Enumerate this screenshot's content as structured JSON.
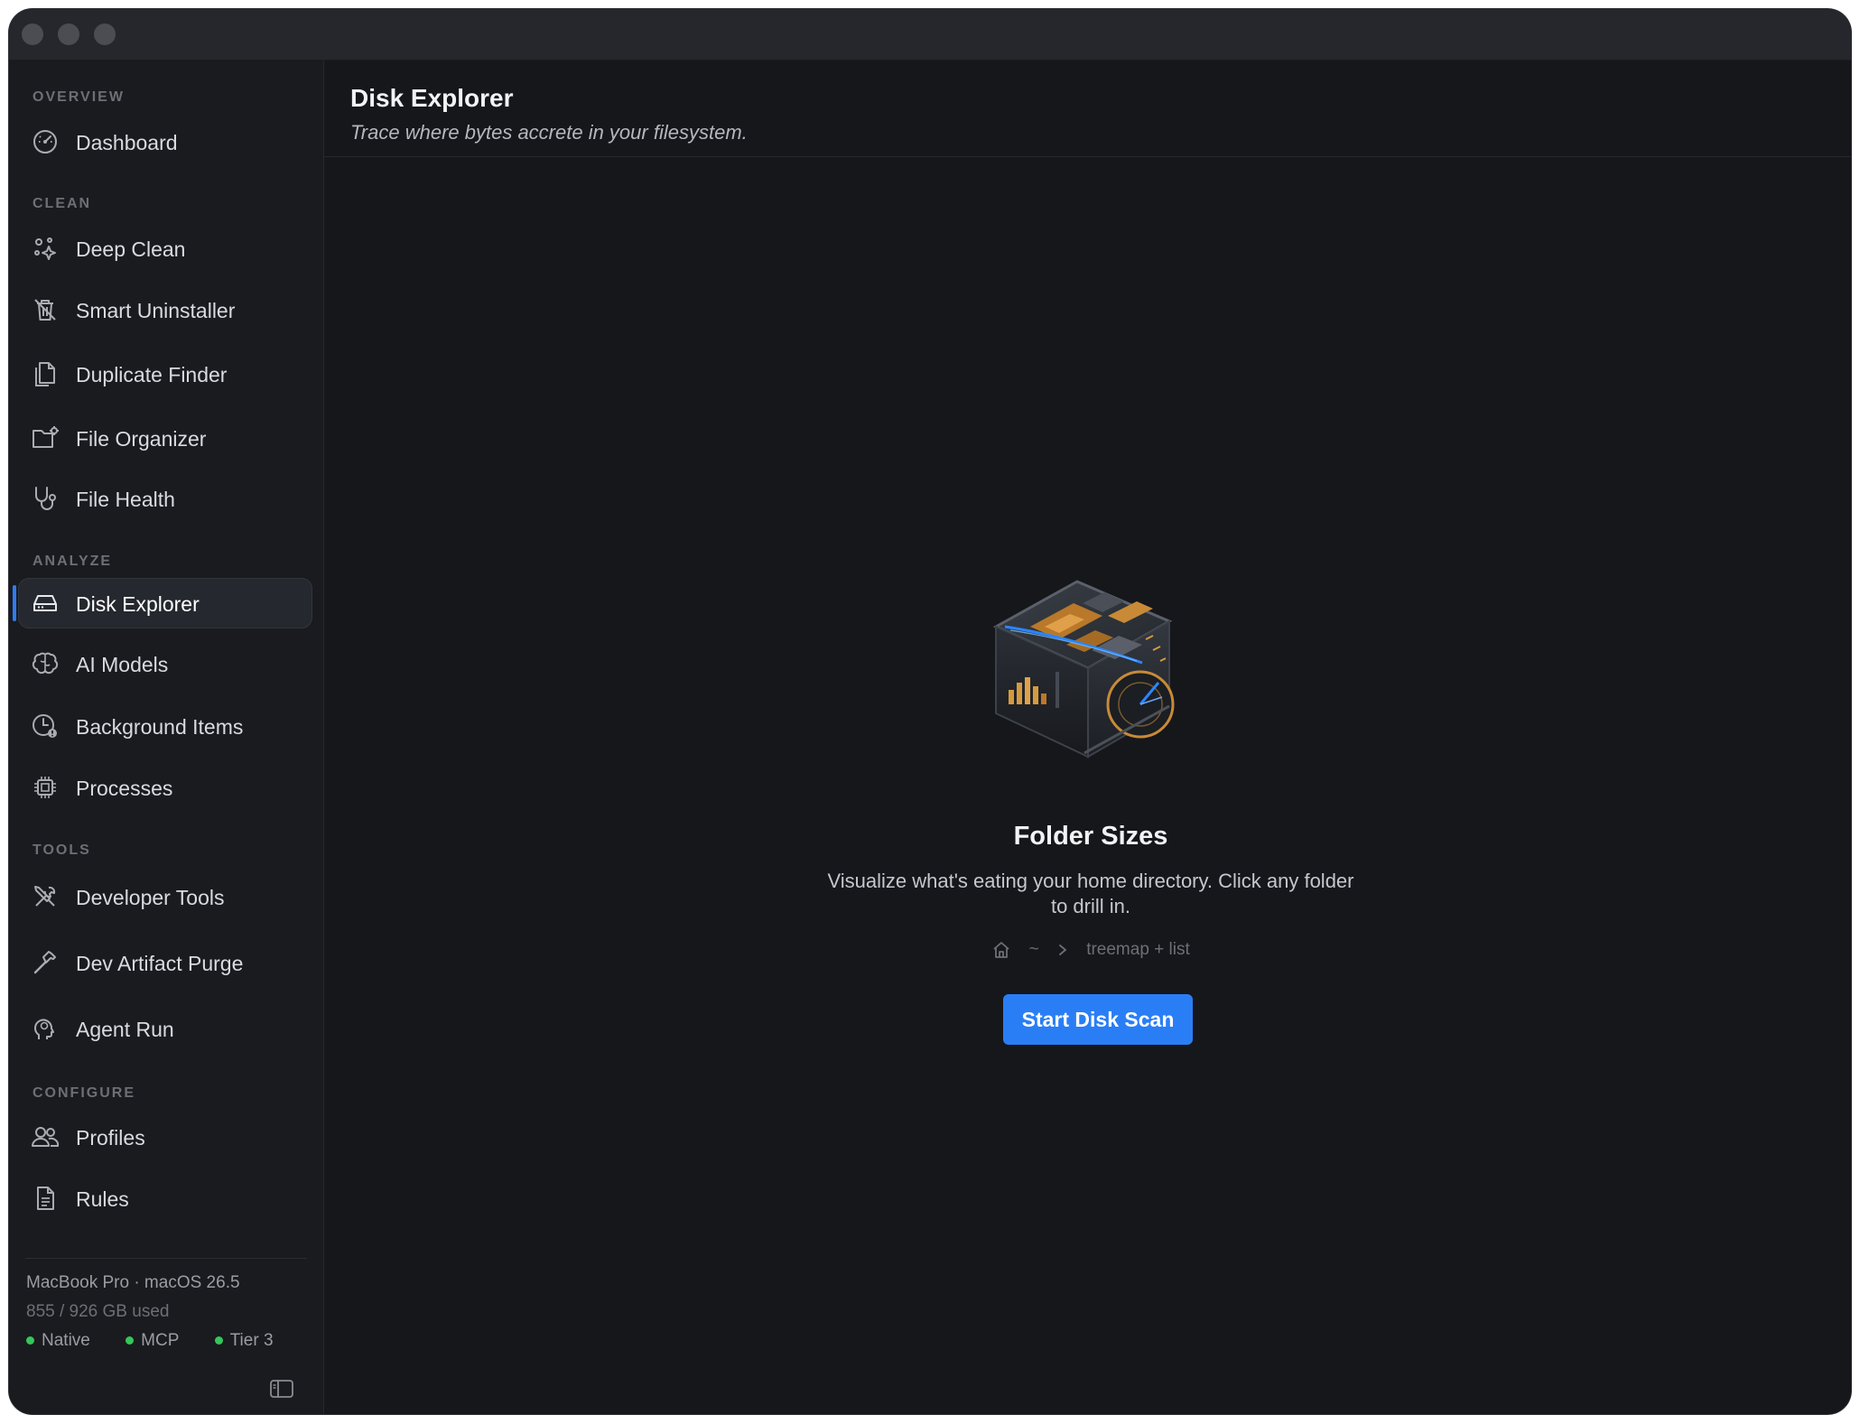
{
  "sidebar": {
    "sections": {
      "overview": "OVERVIEW",
      "clean": "CLEAN",
      "analyze": "ANALYZE",
      "tools": "TOOLS",
      "configure": "CONFIGURE"
    },
    "items": {
      "dashboard": "Dashboard",
      "deep_clean": "Deep Clean",
      "smart_uninstaller": "Smart Uninstaller",
      "duplicate_finder": "Duplicate Finder",
      "file_organizer": "File Organizer",
      "file_health": "File Health",
      "disk_explorer": "Disk Explorer",
      "ai_models": "AI Models",
      "background_items": "Background Items",
      "processes": "Processes",
      "developer_tools": "Developer Tools",
      "dev_artifact_purge": "Dev Artifact Purge",
      "agent_run": "Agent Run",
      "profiles": "Profiles",
      "rules": "Rules"
    },
    "active_item": "disk_explorer",
    "footer": {
      "device": "MacBook Pro · macOS 26.5",
      "storage": "855 / 926 GB used",
      "status": [
        "Native",
        "MCP",
        "Tier 3"
      ],
      "status_color": "#34c759"
    }
  },
  "header": {
    "title": "Disk Explorer",
    "subtitle": "Trace where bytes accrete in your filesystem."
  },
  "empty_state": {
    "title": "Folder Sizes",
    "description": "Visualize what's eating your home directory. Click any folder to drill in.",
    "breadcrumb": {
      "home_icon": "home-icon",
      "path": "~",
      "separator_icon": "chevron-right-icon",
      "mode": "treemap + list"
    },
    "button_label": "Start Disk Scan",
    "accent": "#2a7ef5"
  }
}
